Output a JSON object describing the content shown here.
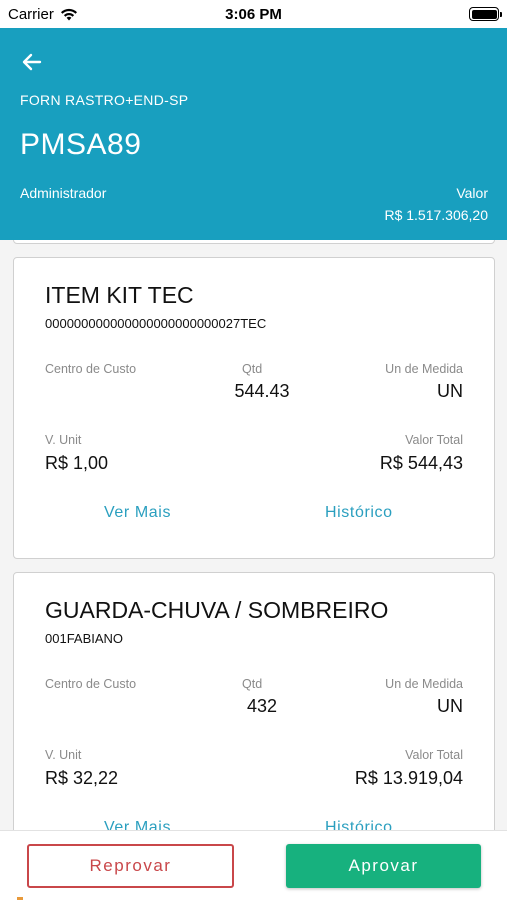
{
  "status_bar": {
    "carrier": "Carrier",
    "time": "3:06 PM",
    "wifi_icon": "wifi-icon",
    "battery_icon": "battery-icon"
  },
  "header": {
    "back_icon": "arrow-left-icon",
    "supplier": "FORN RASTRO+END-SP",
    "document": "PMSA89",
    "role": "Administrador",
    "value_label": "Valor",
    "value_amount": "R$ 1.517.306,20"
  },
  "items": [
    {
      "title": "ITEM KIT TEC",
      "code": "000000000000000000000000027TEC",
      "cost_center_label": "Centro de Custo",
      "cost_center_value": "",
      "qty_label": "Qtd",
      "qty_value": "544.43",
      "unit_label": "Un de Medida",
      "unit_value": "UN",
      "unit_price_label": "V. Unit",
      "unit_price_value": "R$ 1,00",
      "total_label": "Valor Total",
      "total_value": "R$ 544,43",
      "more_label": "Ver Mais",
      "history_label": "Histórico"
    },
    {
      "title": "GUARDA-CHUVA / SOMBREIRO",
      "code": "001FABIANO",
      "cost_center_label": "Centro de Custo",
      "cost_center_value": "",
      "qty_label": "Qtd",
      "qty_value": "432",
      "unit_label": "Un de Medida",
      "unit_value": "UN",
      "unit_price_label": "V. Unit",
      "unit_price_value": "R$ 32,22",
      "total_label": "Valor Total",
      "total_value": "R$ 13.919,04",
      "more_label": "Ver Mais",
      "history_label": "Histórico"
    }
  ],
  "footer": {
    "reject_label": "Reprovar",
    "approve_label": "Aprovar"
  },
  "colors": {
    "header_bg": "#189fbf",
    "link": "#2a9fbf",
    "reject": "#c9474a",
    "approve": "#17b17e"
  }
}
